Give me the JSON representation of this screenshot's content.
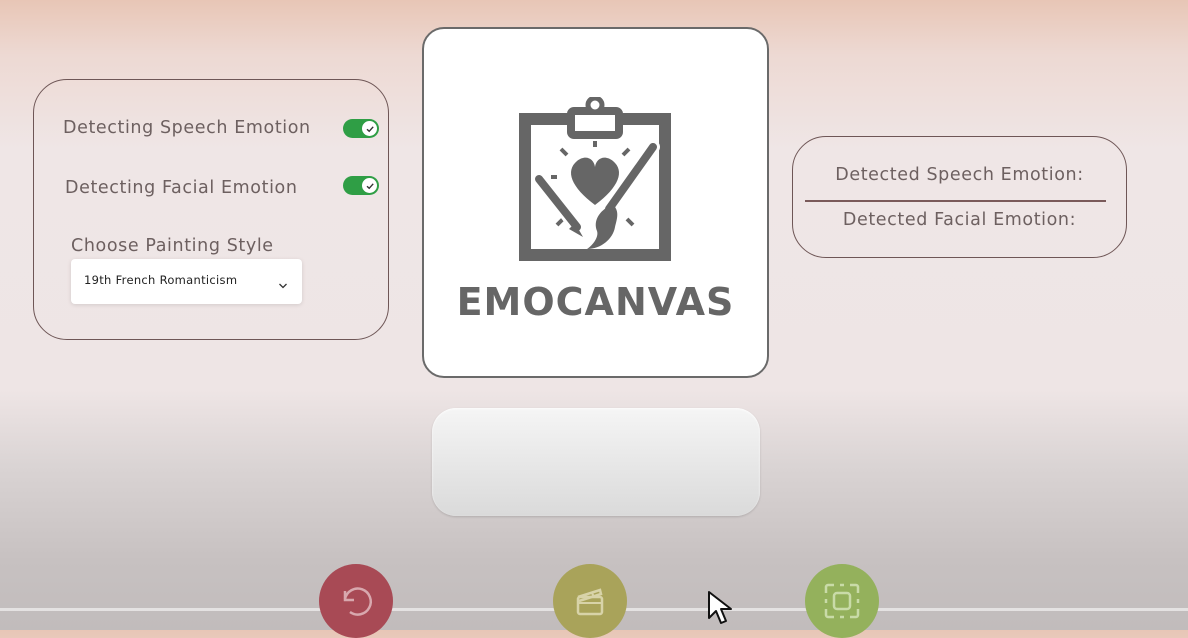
{
  "left_panel": {
    "speech_toggle_label": "Detecting Speech Emotion",
    "speech_toggle_on": true,
    "facial_toggle_label": "Detecting Facial Emotion",
    "facial_toggle_on": true,
    "style_label": "Choose Painting Style",
    "style_selected": "19th French Romanticism"
  },
  "logo": {
    "text": "EMOCANVAS",
    "icon": "clipboard-heart-paintbrush-icon"
  },
  "right_panel": {
    "speech_result_label": "Detected Speech Emotion:",
    "facial_result_label": "Detected Facial Emotion:"
  },
  "bottom_buttons": {
    "reset_icon": "undo-icon",
    "clapper_icon": "clapperboard-icon",
    "capture_icon": "capture-frame-icon"
  },
  "colors": {
    "toggle_on": "#2f9e45",
    "reset_button": "#a84a55",
    "clapper_button": "#a9a35a",
    "capture_button": "#94b15c"
  }
}
